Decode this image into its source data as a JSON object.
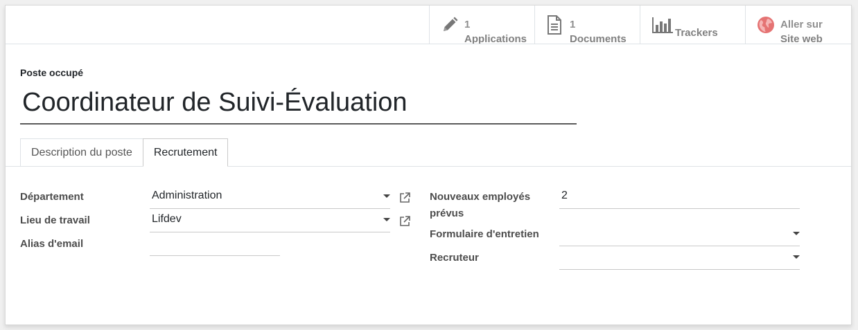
{
  "smart_buttons": [
    {
      "count": "1",
      "label": "Applications",
      "icon": "pencil-icon"
    },
    {
      "count": "1",
      "label": "Documents",
      "icon": "document-icon"
    },
    {
      "count": "",
      "label": "Trackers",
      "icon": "bar-chart-icon"
    },
    {
      "count": "Aller sur",
      "label": "Site web",
      "icon": "globe-icon"
    }
  ],
  "title": {
    "label": "Poste occupé",
    "value": "Coordinateur de Suivi-Évaluation"
  },
  "tabs": [
    {
      "label": "Description du poste"
    },
    {
      "label": "Recrutement"
    }
  ],
  "form": {
    "department": {
      "label": "Département",
      "value": "Administration"
    },
    "work_location": {
      "label": "Lieu de travail",
      "value": "Lifdev"
    },
    "email_alias": {
      "label": "Alias d'email",
      "value": ""
    },
    "new_employees": {
      "label": "Nouveaux employés prévus",
      "value": "2"
    },
    "interview_form": {
      "label": "Formulaire d'entretien",
      "value": ""
    },
    "recruiter": {
      "label": "Recruteur",
      "value": ""
    }
  },
  "colors": {
    "icon_gray": "#777777",
    "globe": "#e57373"
  }
}
